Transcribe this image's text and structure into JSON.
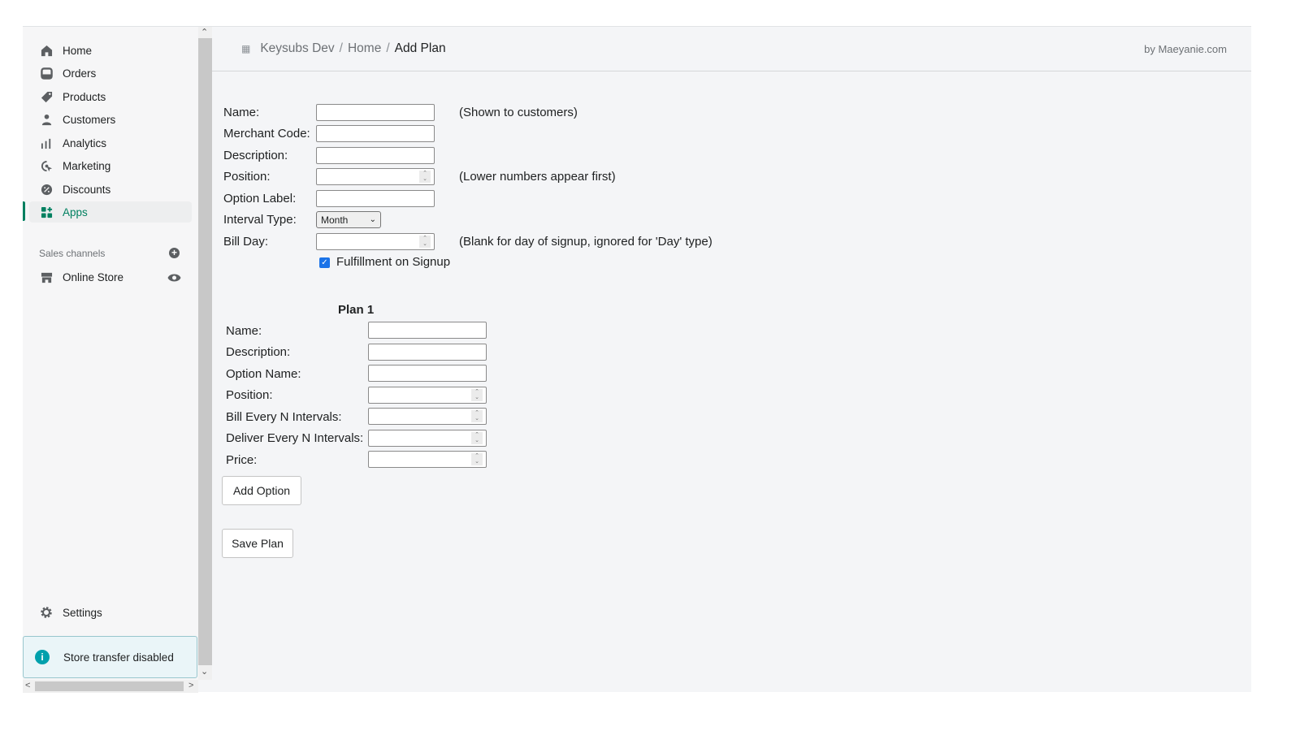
{
  "sidebar": {
    "items": [
      {
        "label": "Home",
        "icon": "home-icon"
      },
      {
        "label": "Orders",
        "icon": "orders-icon"
      },
      {
        "label": "Products",
        "icon": "tag-icon"
      },
      {
        "label": "Customers",
        "icon": "person-icon"
      },
      {
        "label": "Analytics",
        "icon": "bar-chart-icon"
      },
      {
        "label": "Marketing",
        "icon": "marketing-icon"
      },
      {
        "label": "Discounts",
        "icon": "discount-icon"
      },
      {
        "label": "Apps",
        "icon": "apps-icon",
        "active": true
      }
    ],
    "sales_channels_label": "Sales channels",
    "online_store": "Online Store",
    "settings": "Settings",
    "notice": "Store transfer disabled",
    "accent": "#008060"
  },
  "header": {
    "crumbs": [
      "Keysubs Dev",
      "Home",
      "Add Plan"
    ],
    "by": "by Maeyanie.com"
  },
  "form": {
    "name_label": "Name:",
    "name_hint": "(Shown to customers)",
    "merchant_label": "Merchant Code:",
    "description_label": "Description:",
    "position_label": "Position:",
    "position_hint": "(Lower numbers appear first)",
    "option_label_label": "Option Label:",
    "interval_label": "Interval Type:",
    "interval_value": "Month",
    "billday_label": "Bill Day:",
    "billday_hint": "(Blank for day of signup, ignored for 'Day' type)",
    "fulfillment_label": "Fulfillment on Signup",
    "fulfillment_checked": true
  },
  "plan": {
    "title": "Plan 1",
    "name_label": "Name:",
    "description_label": "Description:",
    "option_name_label": "Option Name:",
    "position_label": "Position:",
    "bill_every_label": "Bill Every N Intervals:",
    "deliver_every_label": "Deliver Every N Intervals:",
    "price_label": "Price:"
  },
  "buttons": {
    "add_option": "Add Option",
    "save_plan": "Save Plan"
  }
}
